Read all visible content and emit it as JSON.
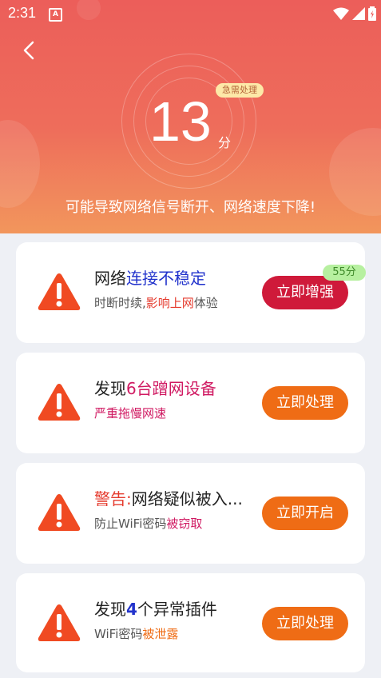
{
  "status_bar": {
    "time": "2:31",
    "notification_icon_letter": "A"
  },
  "header": {
    "score": "13",
    "score_unit": "分",
    "urgent_badge": "急需处理",
    "subtitle": "可能导致网络信号断开、网络速度下降!"
  },
  "colors": {
    "header_top": "#ec5e5a",
    "header_bottom": "#f2965c",
    "btn_enhance": "#cf1a3a",
    "btn_action": "#ef6c15",
    "warning_icon": "#f04a22"
  },
  "cards": [
    {
      "title_pre": "网络",
      "title_hl": "连接不稳定",
      "title_post": "",
      "desc_pre": "时断时续,",
      "desc_hl": "影响上网",
      "desc_post": "体验",
      "button": "立即增强",
      "badge": "55分"
    },
    {
      "title_pre": "发现",
      "title_hl": "6台蹭网设备",
      "title_post": "",
      "desc_pre": "",
      "desc_hl": "严重拖慢网速",
      "desc_post": "",
      "button": "立即处理"
    },
    {
      "title_pre": "",
      "title_hl": "警告:",
      "title_post": "网络疑似被入...",
      "desc_pre": "防止WiFi密码",
      "desc_hl": "被窃取",
      "desc_post": "",
      "button": "立即开启"
    },
    {
      "title_pre": "发现",
      "title_hl": "4",
      "title_post": "个异常插件",
      "desc_pre": "WiFi密码",
      "desc_hl": "被泄露",
      "desc_post": "",
      "button": "立即处理"
    }
  ]
}
